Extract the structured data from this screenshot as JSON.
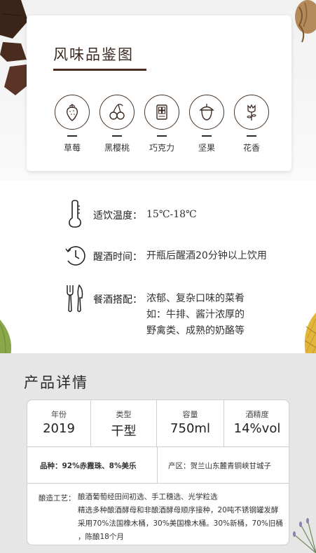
{
  "flavor": {
    "title": "风味品鉴图",
    "items": [
      {
        "label": "草莓",
        "icon": "strawberry-icon"
      },
      {
        "label": "黑樱桃",
        "icon": "cherry-icon"
      },
      {
        "label": "巧克力",
        "icon": "chocolate-icon"
      },
      {
        "label": "坚果",
        "icon": "nut-icon"
      },
      {
        "label": "花香",
        "icon": "flower-icon"
      }
    ]
  },
  "info": {
    "temperature": {
      "label": "适饮温度：",
      "value": "15℃-18℃",
      "icon": "thermometer-icon"
    },
    "decant": {
      "label": "醒酒时间：",
      "value": "开瓶后醒酒20分钟以上饮用",
      "icon": "clock-icon"
    },
    "pairing": {
      "label": "餐酒搭配：",
      "lines": [
        "浓郁、复杂口味的菜肴",
        "如：牛排、酱汁浓厚的",
        "野禽类、成熟的奶酪等"
      ],
      "icon": "cutlery-icon"
    }
  },
  "details": {
    "title": "产品详情",
    "specs": [
      {
        "label": "年份",
        "value": "2019"
      },
      {
        "label": "类型",
        "value": "干型"
      },
      {
        "label": "容量",
        "value": "750ml"
      },
      {
        "label": "酒精度",
        "value": "14%vol"
      }
    ],
    "variety": "品种：92%赤霞珠、8%美乐",
    "origin": "产区：贺兰山东麓青铜峡甘城子",
    "process_label": "酿造工艺：",
    "process_lines": [
      "酿酒葡萄经田间初选、手工穗选、光学粒选",
      "精选多种酿酒酵母和非酿酒酵母顺序接种，20吨不锈钢罐发酵",
      "采用70%法国橡木桶，30%美国橡木桶。30%新桶，70%旧桶",
      "，陈酿18个月"
    ]
  },
  "colors": {
    "accent": "#4a2c20",
    "card_border": "#cfcfcf",
    "detail_bg": "#e6e6e6"
  }
}
